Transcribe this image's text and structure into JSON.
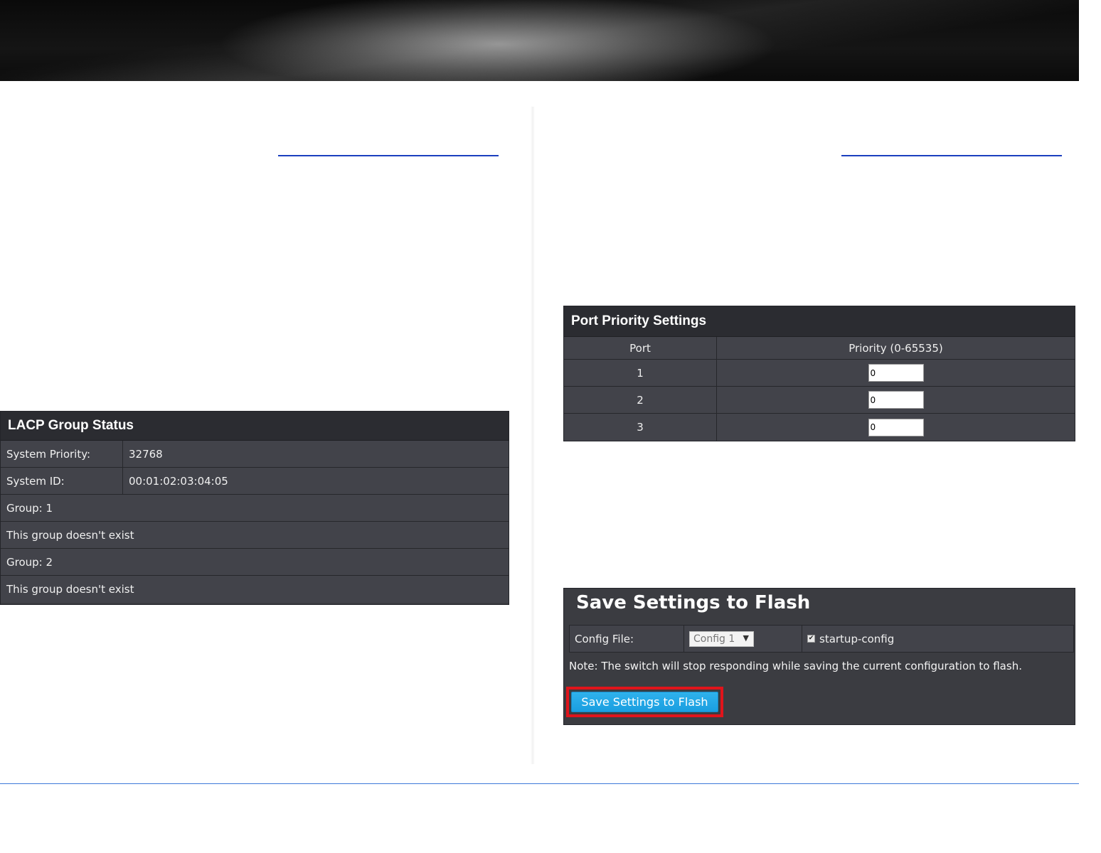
{
  "lacp_group_status": {
    "title": "LACP Group Status",
    "rows": [
      {
        "label": "System Priority:",
        "value": "32768"
      },
      {
        "label": "System ID:",
        "value": "00:01:02:03:04:05"
      }
    ],
    "groups": [
      {
        "heading": "Group: 1",
        "status": "This group doesn't exist"
      },
      {
        "heading": "Group: 2",
        "status": "This group doesn't exist"
      }
    ]
  },
  "port_priority_settings": {
    "title": "Port Priority Settings",
    "columns": [
      "Port",
      "Priority (0-65535)"
    ],
    "rows": [
      {
        "port": "1",
        "priority": "0"
      },
      {
        "port": "2",
        "priority": "0"
      },
      {
        "port": "3",
        "priority": "0"
      }
    ]
  },
  "save_settings": {
    "title": "Save Settings to Flash",
    "config_file_label": "Config File:",
    "config_file_value": "Config 1",
    "startup_config_label": "startup-config",
    "startup_config_checked": true,
    "note": "Note: The switch will stop responding while saving the current configuration to flash.",
    "button_label": "Save Settings to Flash"
  },
  "colors": {
    "panel_bg": "#3b3c41",
    "panel_title_bg": "#2b2c31",
    "button_blue": "#1a9ee0",
    "highlight_red": "#e0141b",
    "link_blue": "#1b3fbf",
    "footer_line": "#3c78d8"
  }
}
